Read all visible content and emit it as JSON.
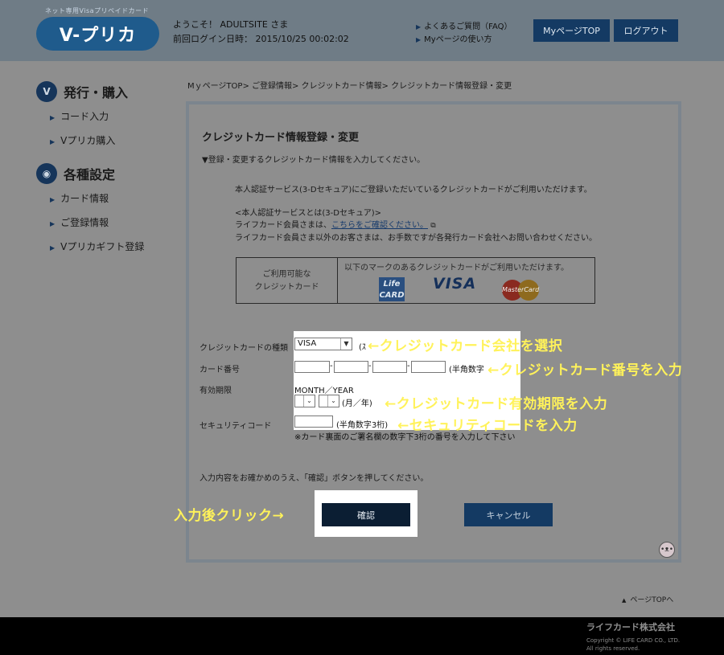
{
  "header": {
    "tagline": "ネット専用Visaプリペイドカード",
    "logo_text": "V-プリカ",
    "welcome": "ようこそ！ ADULTSITE さま",
    "last_login": "前回ログイン日時： 2015/10/25 00:02:02",
    "links": [
      "よくあるご質問（FAQ）",
      "Myページの使い方"
    ],
    "mypage_button": "MyページTOP",
    "logout_button": "ログアウト"
  },
  "sidebar": {
    "section1_title": "発行・購入",
    "section1_items": [
      "コード入力",
      "Vプリカ購入"
    ],
    "section2_title": "各種設定",
    "section2_items": [
      "カード情報",
      "ご登録情報",
      "Vプリカギフト登録"
    ]
  },
  "breadcrumb": "MｙページTOP> ご登録情報> クレジットカード情報> クレジットカード情報登録・変更",
  "main": {
    "title": "クレジットカード情報登録・変更",
    "instruction": "▼登録・変更するクレジットカード情報を入力してください。",
    "info_line1": "本人認証サービス(3-Dセキュア)にご登録いただいているクレジットカードがご利用いただけます。",
    "info_line2": "<本人認証サービスとは(3-Dセキュア)>",
    "info_line3_prefix": "ライフカード会員さまは、",
    "info_line3_link": "こちらをご確認ください。",
    "info_line4": "ライフカード会員さま以外のお客さまは、お手数ですが各発行カード会社へお問い合わせください。",
    "card_table": {
      "left_line1": "ご利用可能な",
      "left_line2": "クレジットカード",
      "right_text": "以下のマークのあるクレジットカードがご利用いただけます。",
      "brands": [
        "Life CARD",
        "VISA",
        "MasterCard"
      ]
    },
    "form": {
      "card_type_label": "クレジットカードの種類",
      "card_type_value": "VISA",
      "card_number_label": "カード番号",
      "card_number_hint": "(半角数字",
      "expiry_label": "有効期限",
      "expiry_caption": "MONTH／YEAR",
      "expiry_unit": "(月／年)",
      "security_label": "セキュリティコード",
      "security_hint": "(半角数字3桁)",
      "security_note": "※カード裏面のご署名欄の数字下3桁の番号を入力して下さい"
    },
    "confirm_prompt": "入力内容をお確かめのうえ、「確認」ボタンを押してください。",
    "confirm_button": "確認",
    "cancel_button": "キャンセル"
  },
  "annotations": {
    "select_company": "←クレジットカード会社を選択",
    "enter_number": "←クレジットカード番号を入力",
    "enter_expiry": "←クレジットカード有効期限を入力",
    "enter_security": "←セキュリティコードを入力",
    "click_after": "入力後クリック→"
  },
  "footer": {
    "page_top": "ページTOPへ",
    "company": "ライフカード株式会社",
    "copyright": "Copyright © LIFE CARD CO., LTD.",
    "rights": "All rights reserved."
  }
}
